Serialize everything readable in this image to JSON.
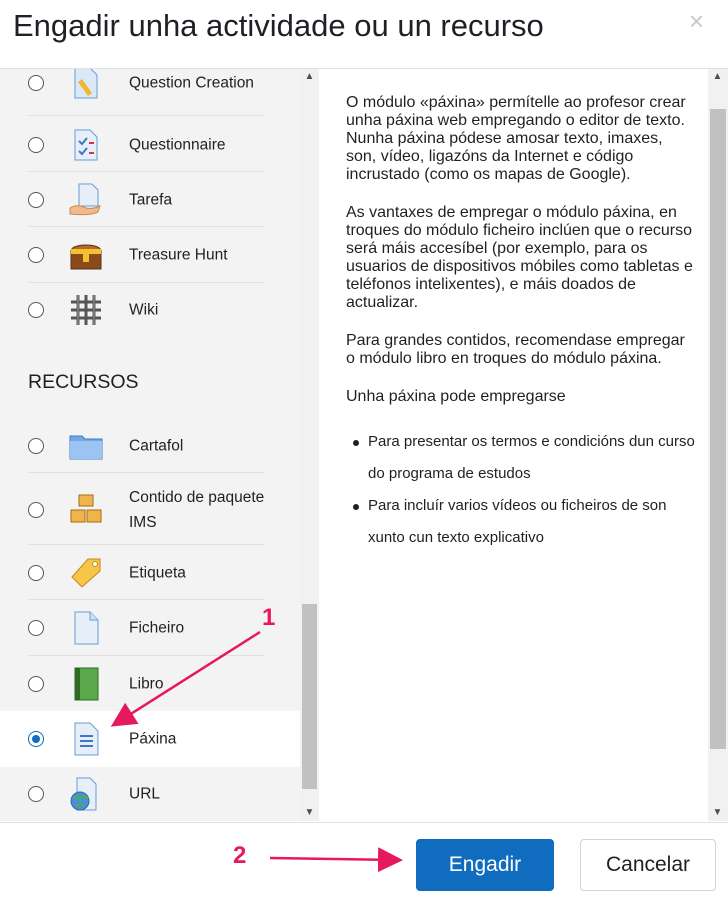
{
  "dialog": {
    "title": "Engadir unha actividade ou un recurso",
    "close_glyph": "×"
  },
  "list": {
    "items": [
      {
        "label": "Question Creation",
        "icon": "question-creation-icon"
      },
      {
        "label": "Questionnaire",
        "icon": "questionnaire-icon"
      },
      {
        "label": "Tarefa",
        "icon": "assignment-icon"
      },
      {
        "label": "Treasure Hunt",
        "icon": "treasure-chest-icon"
      },
      {
        "label": "Wiki",
        "icon": "wiki-icon"
      }
    ],
    "section_title": "RECURSOS",
    "resources": [
      {
        "label": "Cartafol",
        "icon": "folder-icon"
      },
      {
        "label": "Contido de paquete IMS",
        "icon": "ims-package-icon"
      },
      {
        "label": "Etiqueta",
        "icon": "label-tag-icon"
      },
      {
        "label": "Ficheiro",
        "icon": "file-icon"
      },
      {
        "label": "Libro",
        "icon": "book-icon"
      },
      {
        "label": "Páxina",
        "icon": "page-icon",
        "selected": true
      },
      {
        "label": "URL",
        "icon": "url-globe-icon"
      }
    ]
  },
  "description": {
    "paragraphs": [
      "O módulo «páxina» permítelle ao profesor crear unha páxina web empregando o editor de texto. Nunha páxina pódese amosar texto, imaxes, son, vídeo, ligazóns da Internet e código incrustado (como os mapas de Google).",
      "As vantaxes de empregar o módulo páxina, en troques do módulo ficheiro inclúen que o recurso será máis accesíbel (por exemplo, para os usuarios de dispositivos móbiles como tabletas e teléfonos intelixentes), e máis doados de actualizar.",
      "Para grandes contidos, recomendase empregar o módulo libro en troques do módulo páxina.",
      "Unha páxina pode empregarse"
    ],
    "bullets": [
      "Para presentar os termos e condicións dun curso do programa de estudos",
      "Para incluír varios vídeos ou ficheiros de son xunto cun texto explicativo"
    ]
  },
  "footer": {
    "add_label": "Engadir",
    "cancel_label": "Cancelar"
  },
  "annotations": {
    "step1": "1",
    "step2": "2",
    "color": "#e6185f"
  },
  "colors": {
    "primary": "#0f6cbf"
  }
}
